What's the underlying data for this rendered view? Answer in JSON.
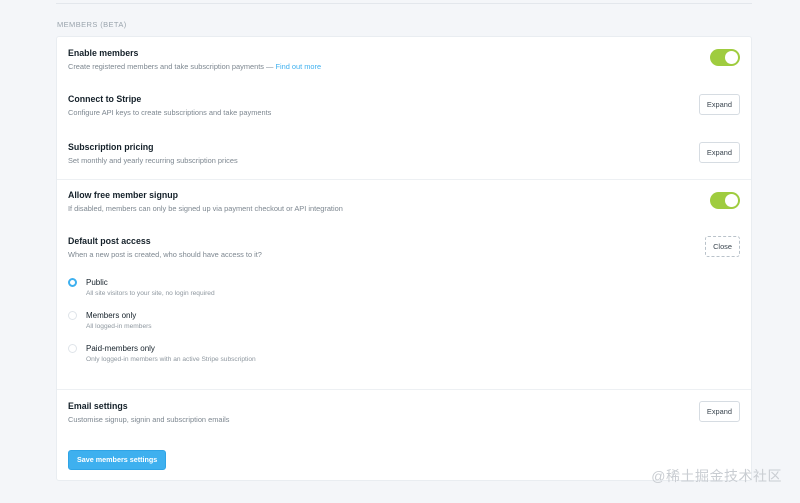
{
  "section": {
    "title": "MEMBERS (BETA)"
  },
  "colors": {
    "accent": "#3eb0ef",
    "toggle_on": "#9fcc3f"
  },
  "settings": {
    "enable_members": {
      "title": "Enable members",
      "desc": "Create registered members and take subscription payments — ",
      "link": "Find out more",
      "toggle": "on"
    },
    "stripe": {
      "title": "Connect to Stripe",
      "desc": "Configure API keys to create subscriptions and take payments",
      "button": "Expand"
    },
    "pricing": {
      "title": "Subscription pricing",
      "desc": "Set monthly and yearly recurring subscription prices",
      "button": "Expand"
    },
    "free_signup": {
      "title": "Allow free member signup",
      "desc": "If disabled, members can only be signed up via payment checkout or API integration",
      "toggle": "on"
    },
    "post_access": {
      "title": "Default post access",
      "desc": "When a new post is created, who should have access to it?",
      "button": "Close",
      "options": [
        {
          "label": "Public",
          "desc": "All site visitors to your site, no login required",
          "selected": true
        },
        {
          "label": "Members only",
          "desc": "All logged-in members",
          "selected": false
        },
        {
          "label": "Paid-members only",
          "desc": "Only logged-in members with an active Stripe subscription",
          "selected": false
        }
      ]
    },
    "email": {
      "title": "Email settings",
      "desc": "Customise signup, signin and subscription emails",
      "button": "Expand"
    }
  },
  "save_button": "Save members settings",
  "watermark": "@稀土掘金技术社区"
}
